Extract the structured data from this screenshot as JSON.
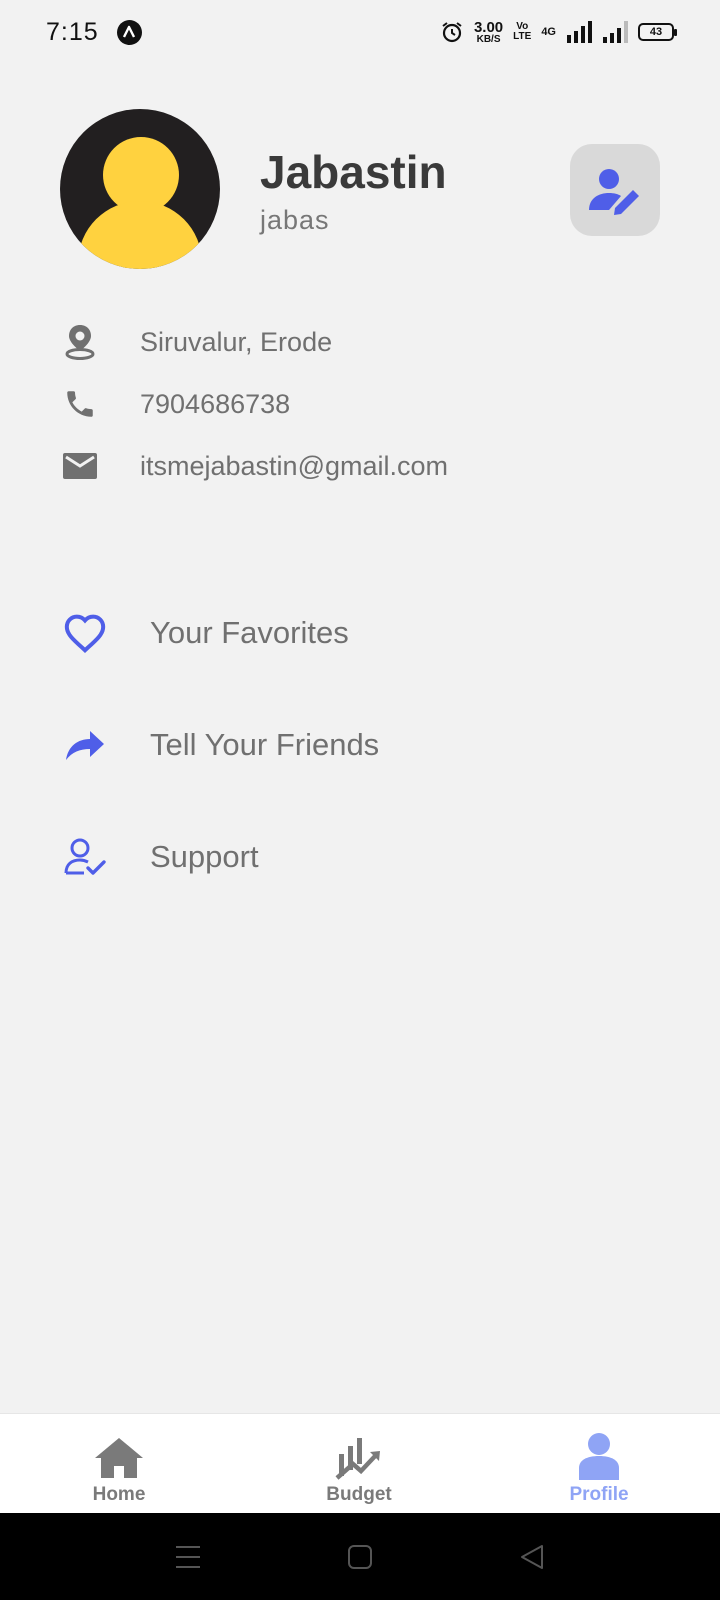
{
  "status_bar": {
    "time": "7:15",
    "speed_value": "3.00",
    "speed_unit": "KB/S",
    "volte_top": "Vo",
    "volte_bottom": "LTE",
    "network": "4G",
    "battery": "43"
  },
  "profile": {
    "name": "Jabastin",
    "username": "jabas",
    "avatar_colors": {
      "background": "#221f20",
      "figure": "#ffd23f"
    }
  },
  "contact": {
    "location": "Siruvalur, Erode",
    "phone": "7904686738",
    "email": "itsmejabastin@gmail.com"
  },
  "menu": [
    {
      "label": "Your Favorites",
      "icon": "heart-icon"
    },
    {
      "label": "Tell Your Friends",
      "icon": "share-icon"
    },
    {
      "label": "Support",
      "icon": "user-check-icon"
    }
  ],
  "bottom_nav": {
    "items": [
      {
        "label": "Home",
        "icon": "home-icon",
        "active": false
      },
      {
        "label": "Budget",
        "icon": "chart-icon",
        "active": false
      },
      {
        "label": "Profile",
        "icon": "profile-icon",
        "active": true
      }
    ]
  },
  "colors": {
    "accent": "#4f5ee8",
    "active_nav": "#8fa4f5",
    "inactive_nav": "#7a7a7a",
    "text": "#707070",
    "background": "#f2f2f2"
  }
}
